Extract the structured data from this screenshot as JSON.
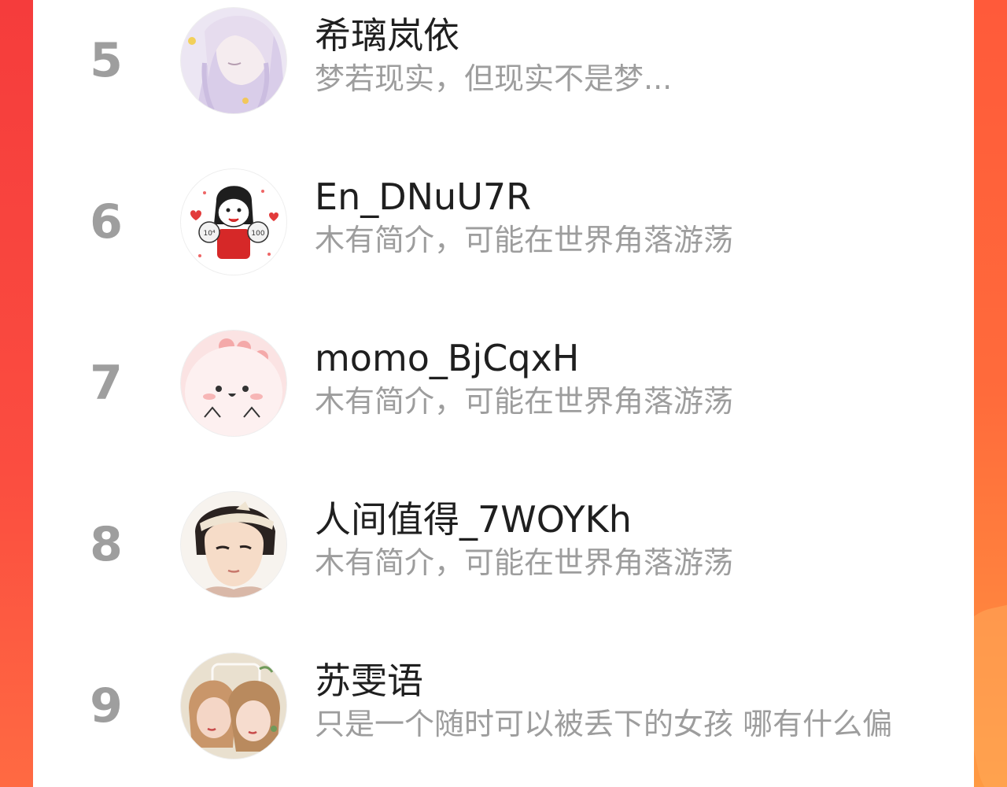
{
  "leaderboard": {
    "entries": [
      {
        "rank": "5",
        "name": "希璃岚依",
        "bio": "梦若现实，但现实不是梦...",
        "avatar_icon": "anime-girl-lavender-avatar"
      },
      {
        "rank": "6",
        "name": "En_DNuU7R",
        "bio": "木有简介，可能在世界角落游荡",
        "avatar_icon": "cartoon-character-hearts-avatar"
      },
      {
        "rank": "7",
        "name": "momo_BjCqxH",
        "bio": "木有简介，可能在世界角落游荡",
        "avatar_icon": "pink-blob-face-avatar"
      },
      {
        "rank": "8",
        "name": "人间值得_7WOYKh",
        "bio": "木有简介，可能在世界角落游荡",
        "avatar_icon": "anime-boy-headband-avatar"
      },
      {
        "rank": "9",
        "name": "苏雯语",
        "bio": "只是一个随时可以被丢下的女孩 哪有什么偏",
        "avatar_icon": "illustrated-women-avatar"
      }
    ]
  },
  "colors": {
    "background_gradient_top": "#fb4a3e",
    "background_gradient_bottom": "#ff9340",
    "panel": "#ffffff",
    "rank_text": "#9e9e9e",
    "name_text": "#1f1f1f",
    "bio_text": "#9d9d9d"
  }
}
